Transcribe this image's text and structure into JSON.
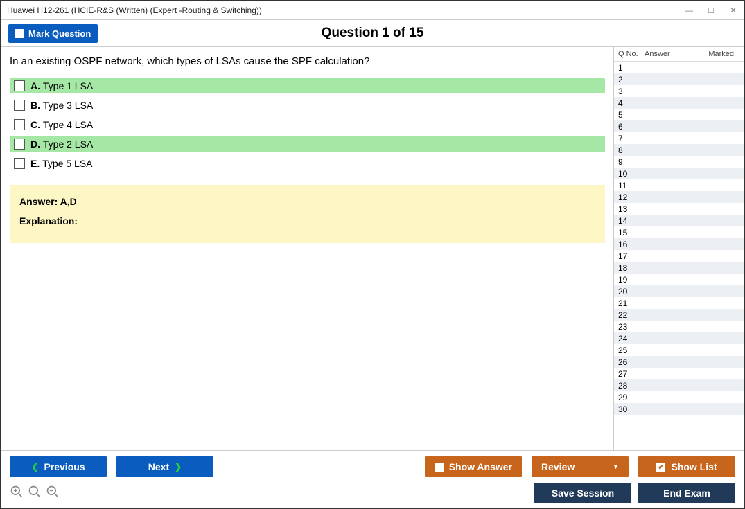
{
  "window": {
    "title": "Huawei H12-261 (HCIE-R&S (Written) (Expert -Routing & Switching))"
  },
  "header": {
    "mark_label": "Mark Question",
    "question_title": "Question 1 of 15"
  },
  "question": {
    "text": "In an existing OSPF network, which types of LSAs cause the SPF calculation?",
    "options": [
      {
        "letter": "A.",
        "text": "Type 1 LSA",
        "correct": true
      },
      {
        "letter": "B.",
        "text": "Type 3 LSA",
        "correct": false
      },
      {
        "letter": "C.",
        "text": "Type 4 LSA",
        "correct": false
      },
      {
        "letter": "D.",
        "text": "Type 2 LSA",
        "correct": true
      },
      {
        "letter": "E.",
        "text": "Type 5 LSA",
        "correct": false
      }
    ]
  },
  "answer_box": {
    "answer_label": "Answer: A,D",
    "explanation_label": "Explanation:"
  },
  "side": {
    "headers": {
      "qno": "Q No.",
      "answer": "Answer",
      "marked": "Marked"
    },
    "count": 30
  },
  "footer": {
    "previous": "Previous",
    "next": "Next",
    "show_answer": "Show Answer",
    "review": "Review",
    "show_list": "Show List",
    "save_session": "Save Session",
    "end_exam": "End Exam"
  }
}
